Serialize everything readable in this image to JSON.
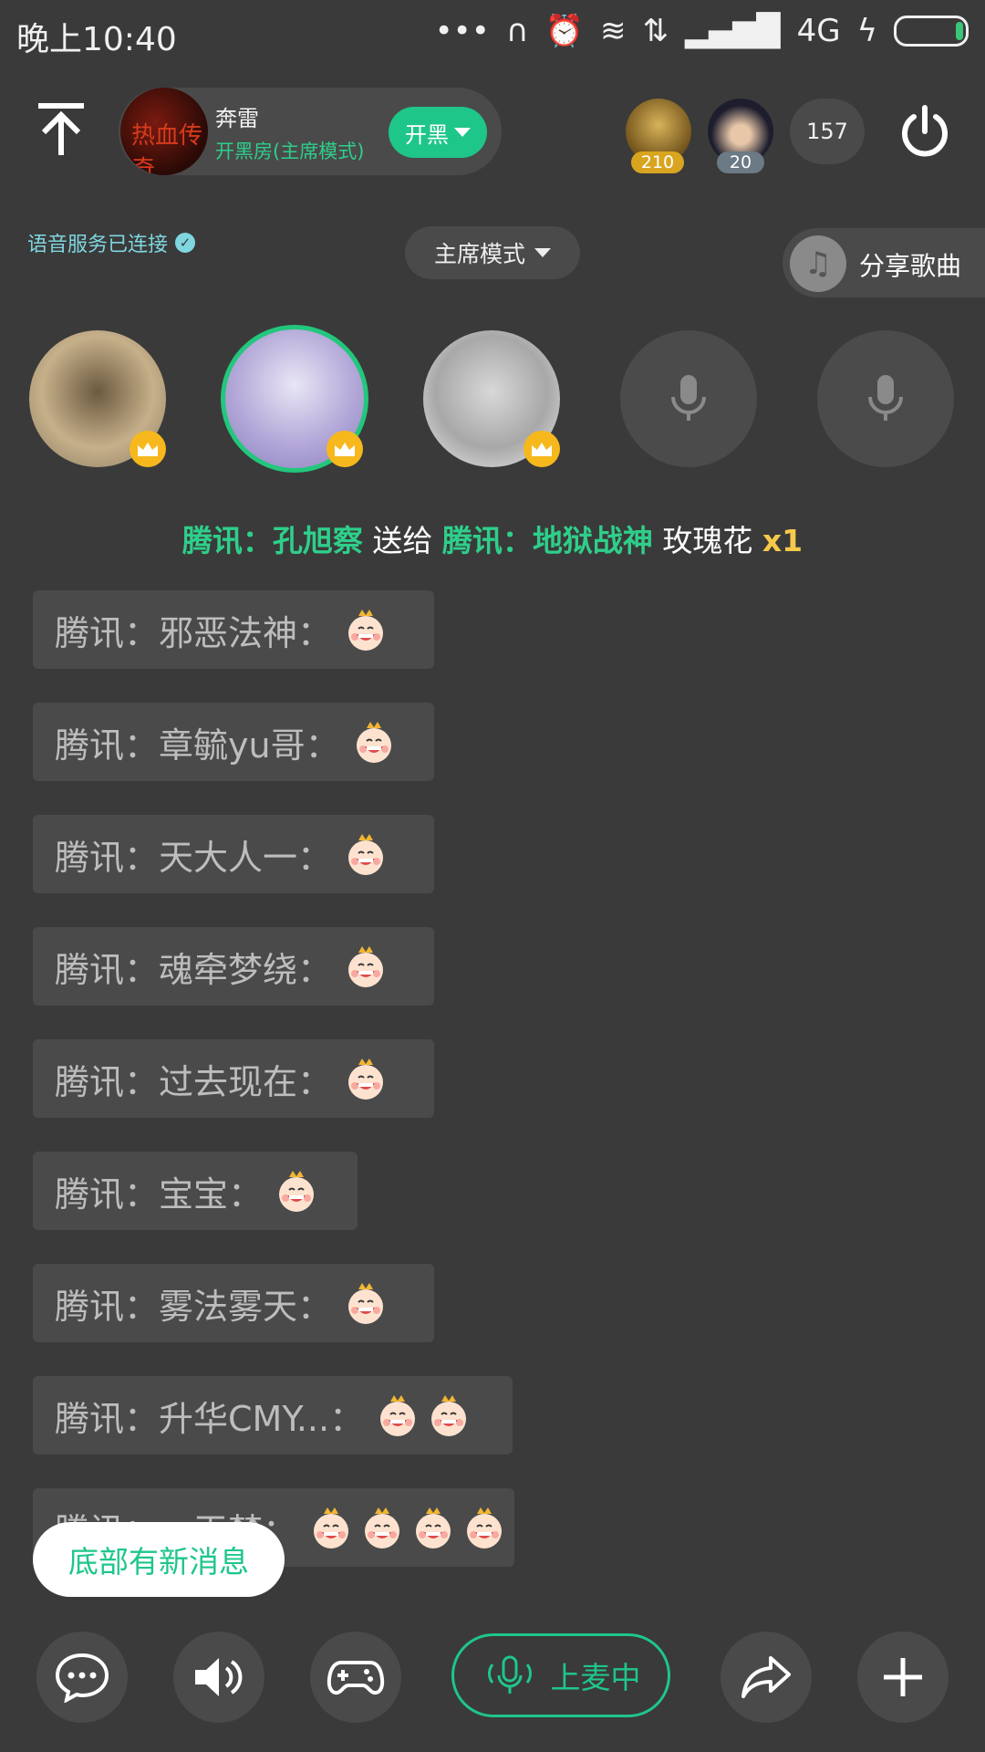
{
  "status_bar": {
    "time": "晚上10:40",
    "network": "4G"
  },
  "header": {
    "room_name": "奔雷",
    "room_subtitle": "开黑房(主席模式)",
    "room_avatar_text": "热血传奇",
    "mode_button": "开黑",
    "top_users": [
      {
        "badge": "210"
      },
      {
        "badge": "20"
      }
    ],
    "online_count": "157"
  },
  "toolbar": {
    "voice_status": "语音服务已连接",
    "mode_selector": "主席模式",
    "share_song": "分享歌曲"
  },
  "gift": {
    "sender": "腾讯：孔旭察",
    "verb": "送给",
    "receiver": "腾讯：地狱战神",
    "item": "玫瑰花",
    "qty": "x1"
  },
  "messages": [
    {
      "text": "腾讯：邪恶法神："
    },
    {
      "text": "腾讯：章毓yu哥："
    },
    {
      "text": "腾讯：天大人一："
    },
    {
      "text": "腾讯：魂牵梦绕："
    },
    {
      "text": "腾讯：过去现在："
    },
    {
      "text": "腾讯：宝宝："
    },
    {
      "text": "腾讯：雾法雾天："
    },
    {
      "text": "腾讯：升华CMY...："
    },
    {
      "text": "腾讯：一天梦："
    }
  ],
  "new_message_toast": "底部有新消息",
  "bottom_bar": {
    "mic_status": "上麦中"
  },
  "colors": {
    "accent": "#1fc68a",
    "background": "#3a3a3a",
    "crown": "#f6b81c",
    "gift_qty": "#f6c94a"
  }
}
